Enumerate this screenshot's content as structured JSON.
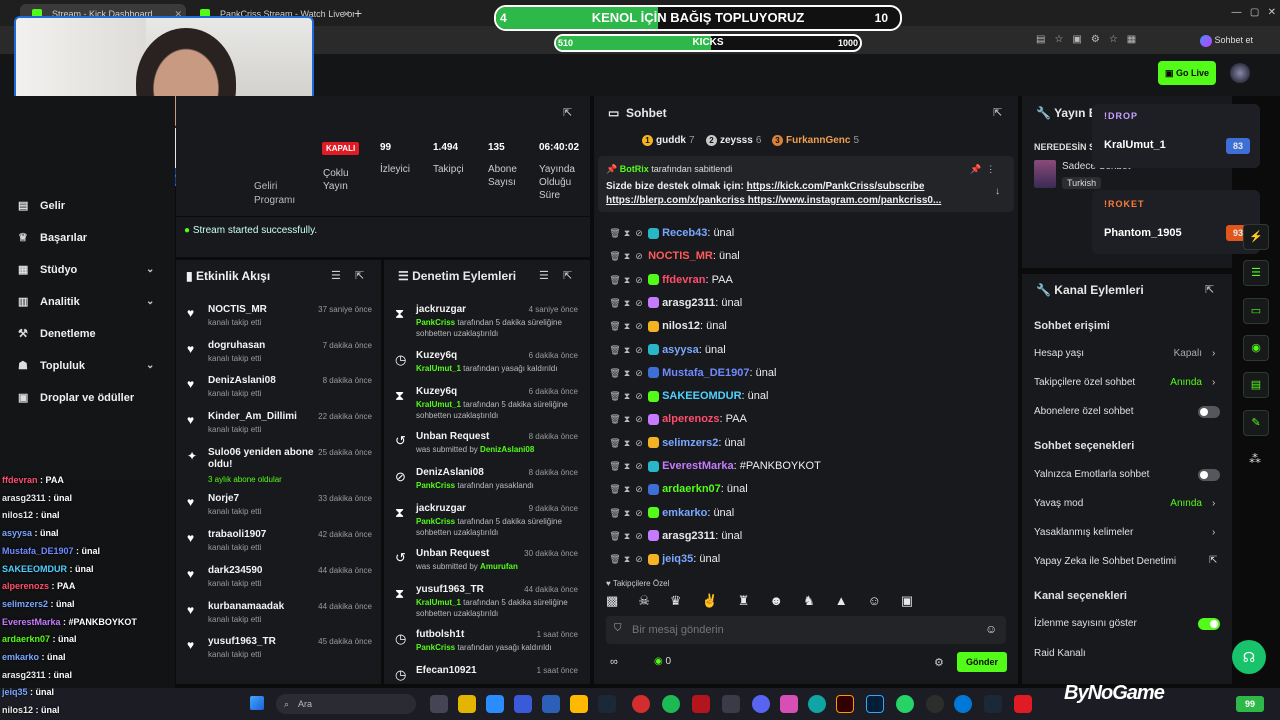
{
  "browser": {
    "tabs": [
      {
        "label": "Stream - Kick Dashboard"
      },
      {
        "label": "PankCriss Stream - Watch Live on"
      }
    ],
    "profile_label": "Sohbet et"
  },
  "donation": {
    "title": "KENOL İÇİN BAĞIŞ TOPLUYORUZ",
    "left": "4",
    "right": "10",
    "progress": 0.4
  },
  "kicks_bar": {
    "label": "KICKS",
    "left": "510",
    "right": "1000",
    "progress": 0.51
  },
  "header": {
    "go_live": "Go Live"
  },
  "sidebar": {
    "items": [
      {
        "label": "Gelir",
        "icon": "money-icon"
      },
      {
        "label": "Başarılar",
        "icon": "trophy-icon"
      },
      {
        "label": "Stüdyo",
        "icon": "studio-icon",
        "chevron": true
      },
      {
        "label": "Analitik",
        "icon": "chart-icon",
        "chevron": true
      },
      {
        "label": "Denetleme",
        "icon": "hammer-icon"
      },
      {
        "label": "Topluluk",
        "icon": "community-icon",
        "chevron": true
      },
      {
        "label": "Droplar ve ödüller",
        "icon": "gift-icon"
      }
    ]
  },
  "stream_info": {
    "partial_label": "Geliri Programı",
    "status_badge": "KAPALI",
    "multi_stream": "Çoklu Yayın",
    "stats": [
      {
        "value": "99",
        "label": "İzleyici"
      },
      {
        "value": "1.494",
        "label": "Takipçi"
      },
      {
        "value": "135",
        "label": "Abone Sayısı"
      },
      {
        "value": "06:40:02",
        "label": "Yayında Olduğu Süre"
      }
    ],
    "success_msg": "Stream started successfully."
  },
  "activity": {
    "title": "Etkinlik Akışı",
    "items": [
      {
        "name": "NOCTIS_MR",
        "sub": "kanalı takip etti",
        "time": "37 saniye önce"
      },
      {
        "name": "dogruhasan",
        "sub": "kanalı takip etti",
        "time": "7 dakika önce"
      },
      {
        "name": "DenizAslani08",
        "sub": "kanalı takip etti",
        "time": "8 dakika önce"
      },
      {
        "name": "Kinder_Am_Dillimi",
        "sub": "kanalı takip etti",
        "time": "22 dakika önce"
      },
      {
        "name": "Sulo06 yeniden abone oldu!",
        "sub": "3 aylık abone oldular",
        "time": "25 dakika önce"
      },
      {
        "name": "Norje7",
        "sub": "kanalı takip etti",
        "time": "33 dakika önce"
      },
      {
        "name": "trabaoli1907",
        "sub": "kanalı takip etti",
        "time": "42 dakika önce"
      },
      {
        "name": "dark234590",
        "sub": "kanalı takip etti",
        "time": "44 dakika önce"
      },
      {
        "name": "kurbanamaadak",
        "sub": "kanalı takip etti",
        "time": "44 dakika önce"
      },
      {
        "name": "yusuf1963_TR",
        "sub": "kanalı takip etti",
        "time": "45 dakika önce"
      }
    ]
  },
  "moderation": {
    "title": "Denetim Eylemleri",
    "items": [
      {
        "name": "jackruzgar",
        "mod": "PankCriss",
        "sub": "tarafından 5 dakika süreliğine sohbetten uzaklaştırıldı",
        "time": "4 saniye önce",
        "icon": "hourglass-icon"
      },
      {
        "name": "Kuzey6q",
        "mod": "KralUmut_1",
        "sub": "tarafından yasağı kaldırıldı",
        "time": "6 dakika önce",
        "icon": "clock-icon"
      },
      {
        "name": "Kuzey6q",
        "mod": "KralUmut_1",
        "sub": "tarafından 5 dakika süreliğine sohbetten uzaklaştırıldı",
        "time": "6 dakika önce",
        "icon": "hourglass-icon"
      },
      {
        "name": "Unban Request",
        "mod": "DenizAslani08",
        "sub": "was submitted by",
        "time": "8 dakika önce",
        "icon": "undo-icon"
      },
      {
        "name": "DenizAslani08",
        "mod": "PankCriss",
        "sub": "tarafından yasaklandı",
        "time": "8 dakika önce",
        "icon": "ban-icon"
      },
      {
        "name": "jackruzgar",
        "mod": "PankCriss",
        "sub": "tarafından 5 dakika süreliğine sohbetten uzaklaştırıldı",
        "time": "9 dakika önce",
        "icon": "hourglass-icon"
      },
      {
        "name": "Unban Request",
        "mod": "Amurufan",
        "sub": "was submitted by",
        "time": "30 dakika önce",
        "icon": "undo-icon"
      },
      {
        "name": "yusuf1963_TR",
        "mod": "KralUmut_1",
        "sub": "tarafından 5 dakika süreliğine sohbetten uzaklaştırıldı",
        "time": "44 dakika önce",
        "icon": "hourglass-icon"
      },
      {
        "name": "futbolsh1t",
        "mod": "PankCriss",
        "sub": "tarafından yasağı kaldırıldı",
        "time": "1 saat önce",
        "icon": "clock-icon"
      },
      {
        "name": "Efecan10921",
        "mod": "",
        "sub": "",
        "time": "1 saat önce",
        "icon": "clock-icon"
      }
    ]
  },
  "chat": {
    "title": "Sohbet",
    "leaders": [
      {
        "rank": "1",
        "name": "guddk",
        "count": "7",
        "color": "#f5b324"
      },
      {
        "rank": "2",
        "name": "zeysss",
        "count": "6",
        "color": "#c9c9c9"
      },
      {
        "rank": "3",
        "name": "FurkannGenc",
        "count": "5",
        "color": "#d9813a"
      }
    ],
    "pinned": {
      "by": "BotRix",
      "by_suffix": "tarafından sabitlendi",
      "text": "Sizde bize destek olmak için:",
      "link1": "https://kick.com/PankCriss/subscribe",
      "link2": "https://blerp.com/x/pankcriss",
      "link3": "https://www.instagram.com/pankcriss0..."
    },
    "messages": [
      {
        "user": "Receb43",
        "text": ": ünal",
        "color": "#7aa7ff"
      },
      {
        "user": "NOCTIS_MR",
        "text": ": ünal",
        "color": "#ff5a5a"
      },
      {
        "user": "ffdevran",
        "text": ": PAA",
        "color": "#ff4d6d"
      },
      {
        "user": "arasg2311",
        "text": ": ünal",
        "color": "#e8e8e8"
      },
      {
        "user": "nilos12",
        "text": ": ünal",
        "color": "#e8e8e8"
      },
      {
        "user": "asyysa",
        "text": ": ünal",
        "color": "#7aa7ff"
      },
      {
        "user": "Mustafa_DE1907",
        "text": ": ünal",
        "color": "#6f8bff"
      },
      {
        "user": "SAKEEOMDUR",
        "text": ": ünal",
        "color": "#4fd1ff"
      },
      {
        "user": "alperenozs",
        "text": ": PAA",
        "color": "#ff4d6d"
      },
      {
        "user": "selimzers2",
        "text": ": ünal",
        "color": "#7aa7ff"
      },
      {
        "user": "EverestMarka",
        "text": ": #PANKBOYKOT",
        "color": "#c67bff"
      },
      {
        "user": "ardaerkn07",
        "text": ": ünal",
        "color": "#53fc18"
      },
      {
        "user": "emkarko",
        "text": ": ünal",
        "color": "#7aa7ff"
      },
      {
        "user": "arasg2311",
        "text": ": ünal",
        "color": "#e8e8e8"
      },
      {
        "user": "jeiq35",
        "text": ": ünal",
        "color": "#7aa7ff"
      }
    ],
    "follower_only": "Takipçilere Özel",
    "input_placeholder": "Bir mesaj gönderin",
    "points": "0",
    "send": "Gönder"
  },
  "stream_details": {
    "title": "Yayın Bilgisi",
    "where": "NEREDESİN SEN",
    "chat_mode": "Sadece Sohbet",
    "language": "Turkish"
  },
  "overlays": {
    "drop_label": "!DROP",
    "drop_user": "KralUmut_1",
    "drop_score": "83",
    "roket_label": "!ROKET",
    "roket_user": "Phantom_1905",
    "roket_score": "93"
  },
  "channel_actions": {
    "title": "Kanal Eylemleri",
    "chat_access": "Sohbet erişimi",
    "account_age": "Hesap yaşı",
    "account_age_val": "Kapalı",
    "followers_only": "Takipçilere özel sohbet",
    "followers_only_val": "Anında",
    "subs_only": "Abonelere özel sohbet",
    "chat_options": "Sohbet seçenekleri",
    "emotes_only": "Yalnızca Emotlarla sohbet",
    "slow_mode": "Yavaş mod",
    "slow_mode_val": "Anında",
    "banned_words": "Yasaklanmış kelimeler",
    "ai_moderation": "Yapay Zeka ile Sohbet Denetimi",
    "channel_options": "Kanal seçenekleri",
    "show_viewers": "İzlenme sayısını göster",
    "raid": "Raid Kanalı"
  },
  "overlay_chat": [
    {
      "user": "ffdevran",
      "text": " : PAA",
      "color": "#ff4d6d"
    },
    {
      "user": "arasg2311",
      "text": " : ünal",
      "color": "#e8e8e8"
    },
    {
      "user": "nilos12",
      "text": " : ünal",
      "color": "#e8e8e8"
    },
    {
      "user": "asyysa",
      "text": " : ünal",
      "color": "#7aa7ff"
    },
    {
      "user": "Mustafa_DE1907",
      "text": " : ünal",
      "color": "#6f8bff"
    },
    {
      "user": "SAKEEOMDUR",
      "text": " : ünal",
      "color": "#4fd1ff"
    },
    {
      "user": "alperenozs",
      "text": " : PAA",
      "color": "#ff4d6d"
    },
    {
      "user": "selimzers2",
      "text": " : ünal",
      "color": "#7aa7ff"
    },
    {
      "user": "EverestMarka",
      "text": " : #PANKBOYKOT",
      "color": "#c67bff"
    },
    {
      "user": "ardaerkn07",
      "text": " : ünal",
      "color": "#53fc18"
    },
    {
      "user": "emkarko",
      "text": " : ünal",
      "color": "#7aa7ff"
    },
    {
      "user": "arasg2311",
      "text": " : ünal",
      "color": "#e8e8e8"
    },
    {
      "user": "jeiq35",
      "text": " : ünal",
      "color": "#7aa7ff"
    },
    {
      "user": "nilos12",
      "text": " : ünal",
      "color": "#e8e8e8"
    }
  ],
  "taskbar": {
    "search": "Ara",
    "watermark": "ByNoGame",
    "battery": "99"
  }
}
